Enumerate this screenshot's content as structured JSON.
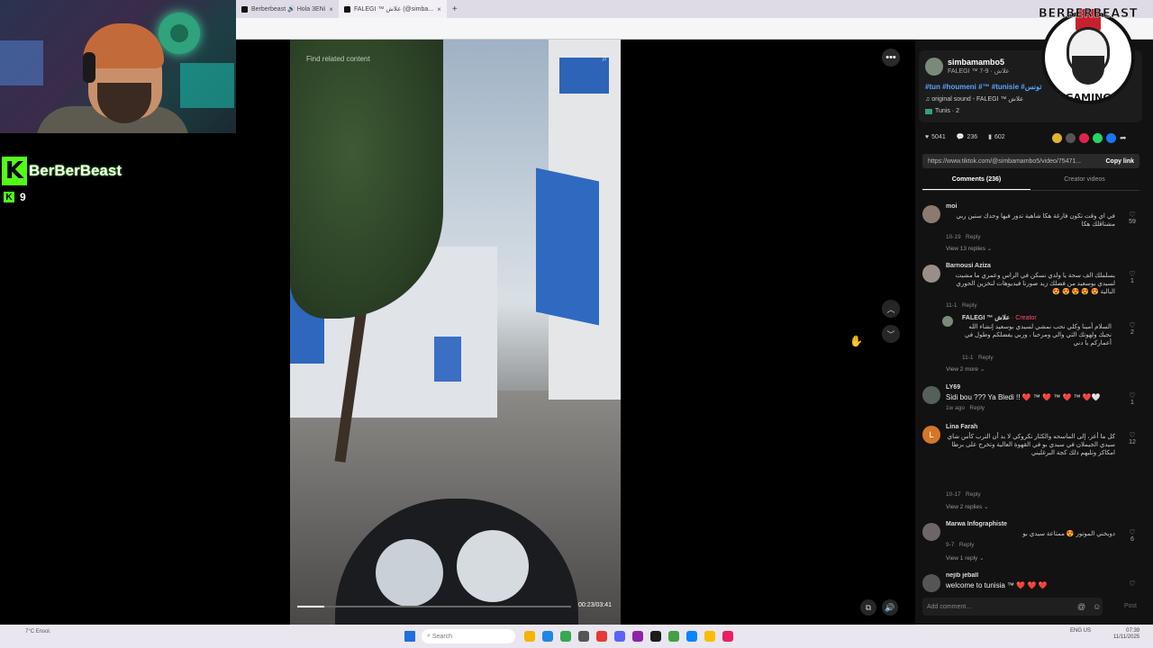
{
  "overlay": {
    "channel_name": "BerBerBeast",
    "kick_letter": "K",
    "viewer_count": "9",
    "logo_top": "BERBERBEAST",
    "logo_bottom": "GAMING"
  },
  "browser": {
    "tabs": [
      {
        "label": "Berberbeast 🔊 Hola 3ENi",
        "active": false
      },
      {
        "label": "FALEGI ™ علاش (@simba...",
        "active": true
      }
    ],
    "new_tab": "+"
  },
  "video": {
    "search_placeholder": "Find related content",
    "timecode": "00:23/03:41",
    "progress": 0.1
  },
  "post": {
    "username": "simbamambo5",
    "subtitle": "FALEGI ™ علاش · 9-7",
    "hashtags": "#tun #houmeni #™ #tunisie #تونس",
    "sound": "♫ original sound - FALEGI ™ علاش",
    "location": "Tunis · 2",
    "likes": "5041",
    "comments_count": "236",
    "saves": "602",
    "url": "https://www.tiktok.com/@simbamambo5/video/75471...",
    "copy_link": "Copy link",
    "tabs": {
      "comments": "Comments (236)",
      "creator": "Creator videos"
    }
  },
  "comments": [
    {
      "name": "moi",
      "text": "في اي وقت تكون فارغة هكا شاهية تدور فيها وحدك ستين ربي مشتاقلك هكا",
      "date": "10-19",
      "reply": "Reply",
      "replies": "View 13 replies ⌄",
      "likes": "59"
    },
    {
      "name": "Barnousi Aziza",
      "text": "يسلملك الف سحة يا ولدي نسكن في الراس وعمري ما مشيت لسيدي بوسعيد من فضلك زيد صورنا فيديوهات لنخزين الحوري البالية 😍 😍 😍 😍 😍",
      "date": "11-1",
      "reply": "Reply",
      "replies": "",
      "likes": "1"
    },
    {
      "name": "FALEGI ™ علاش",
      "creator": "· Creator",
      "text": "السلام أمينا وكلي نحب نمشي لسيدي بوسعيد إنشاء الله نجيك ولهوتك الثي والي ومرحبا ، وربي يفضلكم وطول في أعماركم يا دني",
      "date": "11-1",
      "reply": "Reply",
      "replies": "View 2 more ⌄",
      "likes": "2"
    },
    {
      "name": "LY69",
      "text": "Sidi bou ??? Ya Bledi !! ❤️ ™ ❤️ ™ ❤️ ™ ❤️🤍",
      "date": "1w ago",
      "reply": "Reply",
      "replies": "",
      "likes": "1"
    },
    {
      "name": "Lina Farah",
      "avatar_letter": "L",
      "text": "كل ما أعز، إلى الماسحه والكثار نكروكي لا بد أن الترب كأس شاي سيدي الجيملان في سيدي بو في القهوة العالية وتخرج على برطا امكاكز وتليهم ذلك كجة البرغليني",
      "date": "10-17",
      "reply": "Reply",
      "replies": "View 2 replies ⌄",
      "likes": "12"
    },
    {
      "name": "Marwa Infographiste",
      "text": "دويخني الموتور 😍 ممتاعة سيدي بو",
      "date": "9-7",
      "reply": "Reply",
      "replies": "View 1 reply ⌄",
      "likes": "6"
    },
    {
      "name": "nejib jeball",
      "text": "welcome to tunisia ™ ❤️ ❤️ ❤️",
      "date": "",
      "reply": "",
      "replies": "",
      "likes": ""
    }
  ],
  "footer": {
    "add_comment": "Add comment...",
    "post": "Post"
  },
  "taskbar": {
    "weather": "7°C Ensol.",
    "search": "Search",
    "lang": "ENG US",
    "time": "07:39",
    "date": "11/11/2025"
  },
  "colors": {
    "kick_green": "#53fc18",
    "hashtag_blue": "#5ba4ff",
    "creator_red": "#ff4d6d"
  }
}
